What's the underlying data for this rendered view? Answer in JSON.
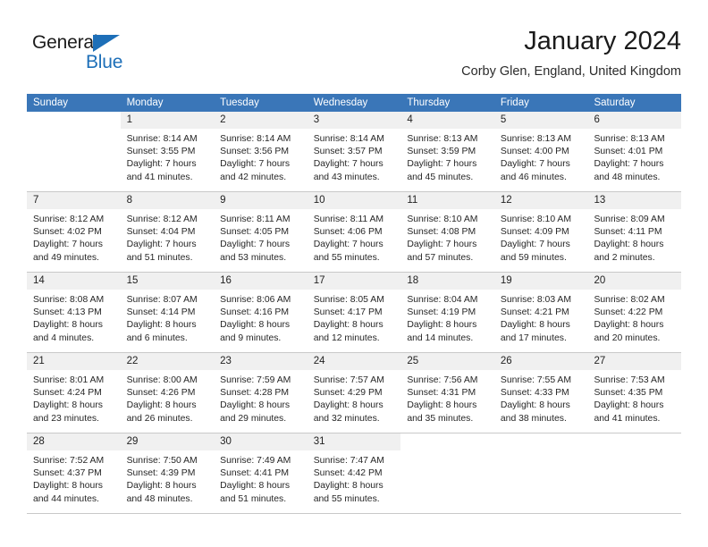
{
  "brand": {
    "name_part1": "General",
    "name_part2": "Blue",
    "triangle_icon": "triangle-icon",
    "accent_color": "#1d6fb8"
  },
  "header": {
    "title": "January 2024",
    "subtitle": "Corby Glen, England, United Kingdom"
  },
  "calendar": {
    "header_color": "#3a76b8",
    "daynum_band_color": "#f0f0f0",
    "weekdays": [
      "Sunday",
      "Monday",
      "Tuesday",
      "Wednesday",
      "Thursday",
      "Friday",
      "Saturday"
    ],
    "weeks": [
      [
        {
          "day": "",
          "blank": true,
          "sunrise": "",
          "sunset": "",
          "daylight_line1": "",
          "daylight_line2": ""
        },
        {
          "day": "1",
          "sunrise": "Sunrise: 8:14 AM",
          "sunset": "Sunset: 3:55 PM",
          "daylight_line1": "Daylight: 7 hours",
          "daylight_line2": "and 41 minutes."
        },
        {
          "day": "2",
          "sunrise": "Sunrise: 8:14 AM",
          "sunset": "Sunset: 3:56 PM",
          "daylight_line1": "Daylight: 7 hours",
          "daylight_line2": "and 42 minutes."
        },
        {
          "day": "3",
          "sunrise": "Sunrise: 8:14 AM",
          "sunset": "Sunset: 3:57 PM",
          "daylight_line1": "Daylight: 7 hours",
          "daylight_line2": "and 43 minutes."
        },
        {
          "day": "4",
          "sunrise": "Sunrise: 8:13 AM",
          "sunset": "Sunset: 3:59 PM",
          "daylight_line1": "Daylight: 7 hours",
          "daylight_line2": "and 45 minutes."
        },
        {
          "day": "5",
          "sunrise": "Sunrise: 8:13 AM",
          "sunset": "Sunset: 4:00 PM",
          "daylight_line1": "Daylight: 7 hours",
          "daylight_line2": "and 46 minutes."
        },
        {
          "day": "6",
          "sunrise": "Sunrise: 8:13 AM",
          "sunset": "Sunset: 4:01 PM",
          "daylight_line1": "Daylight: 7 hours",
          "daylight_line2": "and 48 minutes."
        }
      ],
      [
        {
          "day": "7",
          "sunrise": "Sunrise: 8:12 AM",
          "sunset": "Sunset: 4:02 PM",
          "daylight_line1": "Daylight: 7 hours",
          "daylight_line2": "and 49 minutes."
        },
        {
          "day": "8",
          "sunrise": "Sunrise: 8:12 AM",
          "sunset": "Sunset: 4:04 PM",
          "daylight_line1": "Daylight: 7 hours",
          "daylight_line2": "and 51 minutes."
        },
        {
          "day": "9",
          "sunrise": "Sunrise: 8:11 AM",
          "sunset": "Sunset: 4:05 PM",
          "daylight_line1": "Daylight: 7 hours",
          "daylight_line2": "and 53 minutes."
        },
        {
          "day": "10",
          "sunrise": "Sunrise: 8:11 AM",
          "sunset": "Sunset: 4:06 PM",
          "daylight_line1": "Daylight: 7 hours",
          "daylight_line2": "and 55 minutes."
        },
        {
          "day": "11",
          "sunrise": "Sunrise: 8:10 AM",
          "sunset": "Sunset: 4:08 PM",
          "daylight_line1": "Daylight: 7 hours",
          "daylight_line2": "and 57 minutes."
        },
        {
          "day": "12",
          "sunrise": "Sunrise: 8:10 AM",
          "sunset": "Sunset: 4:09 PM",
          "daylight_line1": "Daylight: 7 hours",
          "daylight_line2": "and 59 minutes."
        },
        {
          "day": "13",
          "sunrise": "Sunrise: 8:09 AM",
          "sunset": "Sunset: 4:11 PM",
          "daylight_line1": "Daylight: 8 hours",
          "daylight_line2": "and 2 minutes."
        }
      ],
      [
        {
          "day": "14",
          "sunrise": "Sunrise: 8:08 AM",
          "sunset": "Sunset: 4:13 PM",
          "daylight_line1": "Daylight: 8 hours",
          "daylight_line2": "and 4 minutes."
        },
        {
          "day": "15",
          "sunrise": "Sunrise: 8:07 AM",
          "sunset": "Sunset: 4:14 PM",
          "daylight_line1": "Daylight: 8 hours",
          "daylight_line2": "and 6 minutes."
        },
        {
          "day": "16",
          "sunrise": "Sunrise: 8:06 AM",
          "sunset": "Sunset: 4:16 PM",
          "daylight_line1": "Daylight: 8 hours",
          "daylight_line2": "and 9 minutes."
        },
        {
          "day": "17",
          "sunrise": "Sunrise: 8:05 AM",
          "sunset": "Sunset: 4:17 PM",
          "daylight_line1": "Daylight: 8 hours",
          "daylight_line2": "and 12 minutes."
        },
        {
          "day": "18",
          "sunrise": "Sunrise: 8:04 AM",
          "sunset": "Sunset: 4:19 PM",
          "daylight_line1": "Daylight: 8 hours",
          "daylight_line2": "and 14 minutes."
        },
        {
          "day": "19",
          "sunrise": "Sunrise: 8:03 AM",
          "sunset": "Sunset: 4:21 PM",
          "daylight_line1": "Daylight: 8 hours",
          "daylight_line2": "and 17 minutes."
        },
        {
          "day": "20",
          "sunrise": "Sunrise: 8:02 AM",
          "sunset": "Sunset: 4:22 PM",
          "daylight_line1": "Daylight: 8 hours",
          "daylight_line2": "and 20 minutes."
        }
      ],
      [
        {
          "day": "21",
          "sunrise": "Sunrise: 8:01 AM",
          "sunset": "Sunset: 4:24 PM",
          "daylight_line1": "Daylight: 8 hours",
          "daylight_line2": "and 23 minutes."
        },
        {
          "day": "22",
          "sunrise": "Sunrise: 8:00 AM",
          "sunset": "Sunset: 4:26 PM",
          "daylight_line1": "Daylight: 8 hours",
          "daylight_line2": "and 26 minutes."
        },
        {
          "day": "23",
          "sunrise": "Sunrise: 7:59 AM",
          "sunset": "Sunset: 4:28 PM",
          "daylight_line1": "Daylight: 8 hours",
          "daylight_line2": "and 29 minutes."
        },
        {
          "day": "24",
          "sunrise": "Sunrise: 7:57 AM",
          "sunset": "Sunset: 4:29 PM",
          "daylight_line1": "Daylight: 8 hours",
          "daylight_line2": "and 32 minutes."
        },
        {
          "day": "25",
          "sunrise": "Sunrise: 7:56 AM",
          "sunset": "Sunset: 4:31 PM",
          "daylight_line1": "Daylight: 8 hours",
          "daylight_line2": "and 35 minutes."
        },
        {
          "day": "26",
          "sunrise": "Sunrise: 7:55 AM",
          "sunset": "Sunset: 4:33 PM",
          "daylight_line1": "Daylight: 8 hours",
          "daylight_line2": "and 38 minutes."
        },
        {
          "day": "27",
          "sunrise": "Sunrise: 7:53 AM",
          "sunset": "Sunset: 4:35 PM",
          "daylight_line1": "Daylight: 8 hours",
          "daylight_line2": "and 41 minutes."
        }
      ],
      [
        {
          "day": "28",
          "sunrise": "Sunrise: 7:52 AM",
          "sunset": "Sunset: 4:37 PM",
          "daylight_line1": "Daylight: 8 hours",
          "daylight_line2": "and 44 minutes."
        },
        {
          "day": "29",
          "sunrise": "Sunrise: 7:50 AM",
          "sunset": "Sunset: 4:39 PM",
          "daylight_line1": "Daylight: 8 hours",
          "daylight_line2": "and 48 minutes."
        },
        {
          "day": "30",
          "sunrise": "Sunrise: 7:49 AM",
          "sunset": "Sunset: 4:41 PM",
          "daylight_line1": "Daylight: 8 hours",
          "daylight_line2": "and 51 minutes."
        },
        {
          "day": "31",
          "sunrise": "Sunrise: 7:47 AM",
          "sunset": "Sunset: 4:42 PM",
          "daylight_line1": "Daylight: 8 hours",
          "daylight_line2": "and 55 minutes."
        },
        {
          "day": "",
          "blank": true,
          "sunrise": "",
          "sunset": "",
          "daylight_line1": "",
          "daylight_line2": ""
        },
        {
          "day": "",
          "blank": true,
          "sunrise": "",
          "sunset": "",
          "daylight_line1": "",
          "daylight_line2": ""
        },
        {
          "day": "",
          "blank": true,
          "sunrise": "",
          "sunset": "",
          "daylight_line1": "",
          "daylight_line2": ""
        }
      ]
    ]
  }
}
